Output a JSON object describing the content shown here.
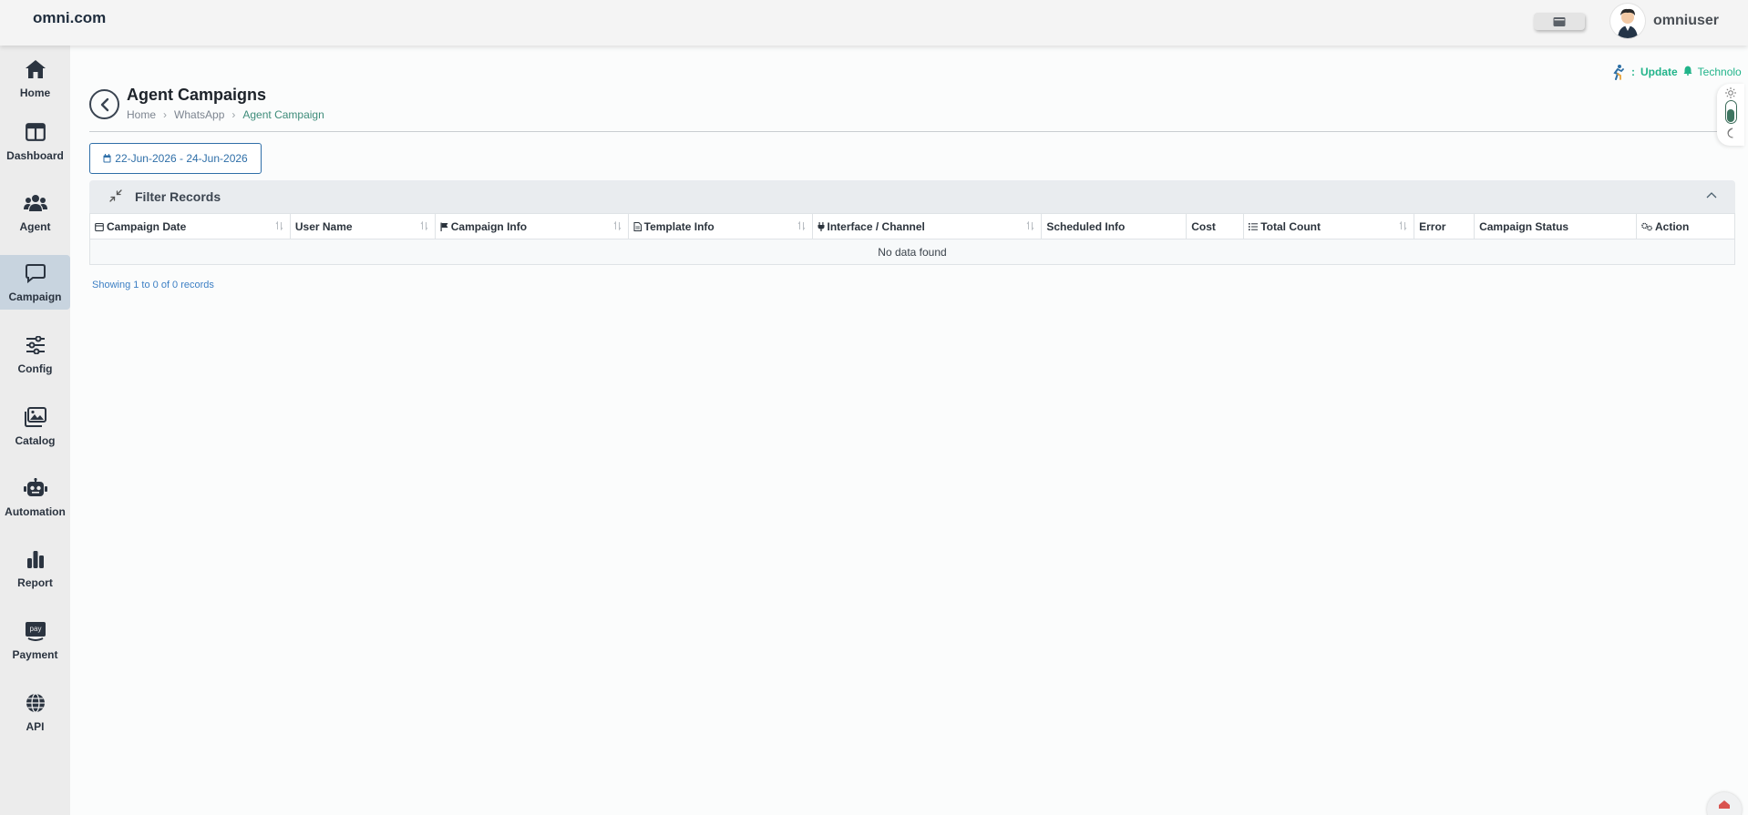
{
  "app": {
    "brand": "omni.com",
    "username": "omniuser"
  },
  "sidebar": {
    "items": [
      {
        "label": "Home",
        "icon": "home-icon"
      },
      {
        "label": "Dashboard",
        "icon": "dashboard-icon"
      },
      {
        "label": "Agent",
        "icon": "users-icon"
      },
      {
        "label": "Campaign",
        "icon": "chat-icon",
        "active": true
      },
      {
        "label": "Config",
        "icon": "sliders-icon"
      },
      {
        "label": "Catalog",
        "icon": "images-icon"
      },
      {
        "label": "Automation",
        "icon": "robot-icon"
      },
      {
        "label": "Report",
        "icon": "bar-chart-icon"
      },
      {
        "label": "Payment",
        "icon": "pay-icon"
      },
      {
        "label": "API",
        "icon": "globe-icon"
      }
    ]
  },
  "header": {
    "title": "Agent Campaigns",
    "breadcrumb": [
      "Home",
      "WhatsApp",
      "Agent Campaign"
    ]
  },
  "notice": {
    "prefix": ":",
    "update": "Update",
    "company": "Technolo"
  },
  "date_range": "22-Jun-2026 - 24-Jun-2026",
  "filter": {
    "title": "Filter Records"
  },
  "table": {
    "columns": [
      "Campaign Date",
      "User Name",
      "Campaign Info",
      "Template Info",
      "Interface / Channel",
      "Scheduled Info",
      "Cost",
      "Total Count",
      "Error",
      "Campaign Status",
      "Action"
    ],
    "empty_text": "No data found",
    "records_text": "Showing 1 to 0 of 0 records"
  },
  "colors": {
    "accent_green": "#3e8c7a",
    "link_blue": "#2f6fa8",
    "notice_green": "#21b48a",
    "active_nav": "#c8d4df"
  }
}
